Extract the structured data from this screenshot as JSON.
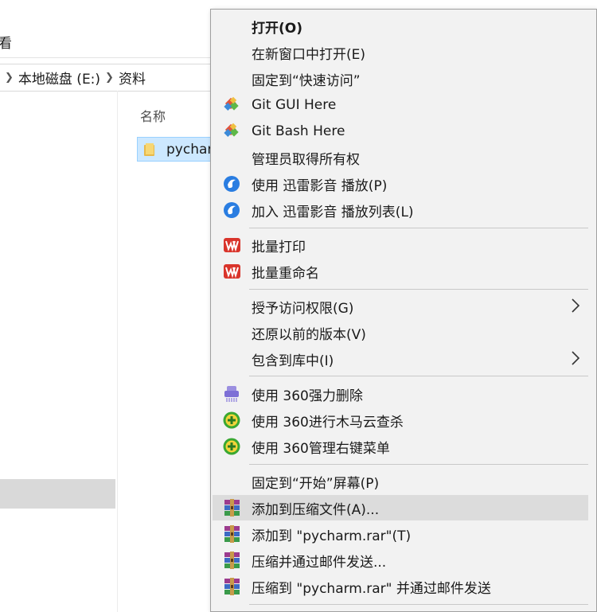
{
  "explorer": {
    "ribbon_tab": "看",
    "breadcrumb": [
      "本地磁盘 (E:)",
      "资料"
    ],
    "column_header": "名称",
    "selected_file": "pycharm"
  },
  "menu": {
    "items": [
      {
        "label": "打开(O)",
        "icon": "none",
        "bold": true
      },
      {
        "label": "在新窗口中打开(E)",
        "icon": "none"
      },
      {
        "label": "固定到“快速访问”",
        "icon": "none"
      },
      {
        "label": "Git GUI Here",
        "icon": "git-icon"
      },
      {
        "label": "Git Bash Here",
        "icon": "git-icon"
      },
      {
        "label": "管理员取得所有权",
        "icon": "none"
      },
      {
        "label": "使用 迅雷影音 播放(P)",
        "icon": "xunlei-icon"
      },
      {
        "label": "加入 迅雷影音 播放列表(L)",
        "icon": "xunlei-icon"
      },
      {
        "label": "批量打印",
        "icon": "wps-icon"
      },
      {
        "label": "批量重命名",
        "icon": "wps-icon"
      },
      {
        "label": "授予访问权限(G)",
        "icon": "none",
        "submenu": true
      },
      {
        "label": "还原以前的版本(V)",
        "icon": "none"
      },
      {
        "label": "包含到库中(I)",
        "icon": "none",
        "submenu": true
      },
      {
        "label": "使用 360强力删除",
        "icon": "shredder-icon"
      },
      {
        "label": "使用 360进行木马云查杀",
        "icon": "360-icon"
      },
      {
        "label": "使用 360管理右键菜单",
        "icon": "360-icon"
      },
      {
        "label": "固定到“开始”屏幕(P)",
        "icon": "none"
      },
      {
        "label": "添加到压缩文件(A)...",
        "icon": "winrar-icon",
        "hovered": true
      },
      {
        "label": "添加到 \"pycharm.rar\"(T)",
        "icon": "winrar-icon"
      },
      {
        "label": "压缩并通过邮件发送...",
        "icon": "winrar-icon"
      },
      {
        "label": "压缩到 \"pycharm.rar\" 并通过邮件发送",
        "icon": "winrar-icon"
      }
    ]
  },
  "colors": {
    "menu_bg": "#f2f2f2",
    "menu_hover": "#dcdcdc",
    "selection": "#cce8ff",
    "git_red": "#e0533b",
    "xunlei_blue": "#2a7de1",
    "wps_red": "#d9342b",
    "green_360": "#3aa832"
  }
}
